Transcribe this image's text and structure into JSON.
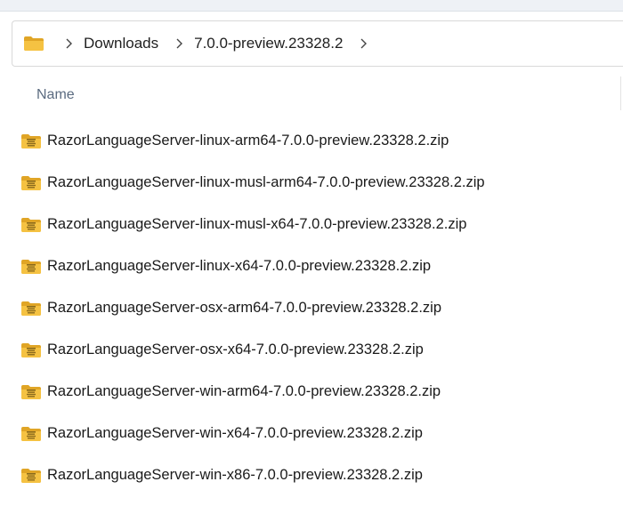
{
  "breadcrumb": {
    "items": [
      "Downloads",
      "7.0.0-preview.23328.2"
    ]
  },
  "columns": {
    "name": "Name"
  },
  "files": [
    {
      "name": "RazorLanguageServer-linux-arm64-7.0.0-preview.23328.2.zip",
      "icon": "zip-folder-icon"
    },
    {
      "name": "RazorLanguageServer-linux-musl-arm64-7.0.0-preview.23328.2.zip",
      "icon": "zip-folder-icon"
    },
    {
      "name": "RazorLanguageServer-linux-musl-x64-7.0.0-preview.23328.2.zip",
      "icon": "zip-folder-icon"
    },
    {
      "name": "RazorLanguageServer-linux-x64-7.0.0-preview.23328.2.zip",
      "icon": "zip-folder-icon"
    },
    {
      "name": "RazorLanguageServer-osx-arm64-7.0.0-preview.23328.2.zip",
      "icon": "zip-folder-icon"
    },
    {
      "name": "RazorLanguageServer-osx-x64-7.0.0-preview.23328.2.zip",
      "icon": "zip-folder-icon"
    },
    {
      "name": "RazorLanguageServer-win-arm64-7.0.0-preview.23328.2.zip",
      "icon": "zip-folder-icon"
    },
    {
      "name": "RazorLanguageServer-win-x64-7.0.0-preview.23328.2.zip",
      "icon": "zip-folder-icon"
    },
    {
      "name": "RazorLanguageServer-win-x86-7.0.0-preview.23328.2.zip",
      "icon": "zip-folder-icon"
    }
  ],
  "colors": {
    "folder": "#f5c242",
    "folder_dark": "#e0a526",
    "header_text": "#5b6b80"
  }
}
